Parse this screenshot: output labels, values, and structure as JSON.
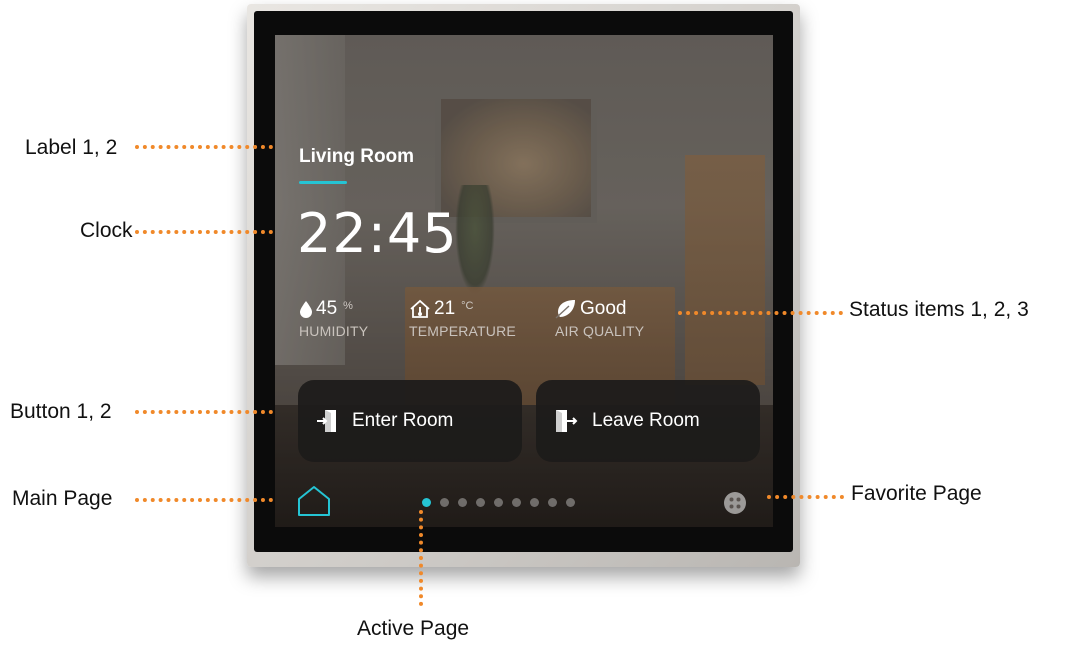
{
  "callouts": {
    "label": "Label 1, 2",
    "clock": "Clock",
    "status": "Status items 1, 2, 3",
    "button": "Button 1, 2",
    "main_page": "Main Page",
    "favorite_page": "Favorite Page",
    "active_page": "Active Page"
  },
  "screen": {
    "room_label": "Living Room",
    "clock": "22:45",
    "status_items": [
      {
        "icon": "water-drop-icon",
        "value": "45",
        "unit": "%",
        "caption": "HUMIDITY"
      },
      {
        "icon": "home-thermometer-icon",
        "value": "21",
        "unit": "°C",
        "caption": "TEMPERATURE"
      },
      {
        "icon": "leaf-icon",
        "value": "Good",
        "unit": "",
        "caption": "AIR QUALITY"
      }
    ],
    "buttons": [
      {
        "icon": "enter-door-icon",
        "label": "Enter Room"
      },
      {
        "icon": "exit-door-icon",
        "label": "Leave Room"
      }
    ],
    "navigation": {
      "main_icon": "home-icon",
      "favorite_icon": "grid-icon",
      "page_count": 9,
      "active_page": 1
    }
  },
  "colors": {
    "accent": "#25c4d4",
    "callout_dots": "#f0892a"
  }
}
